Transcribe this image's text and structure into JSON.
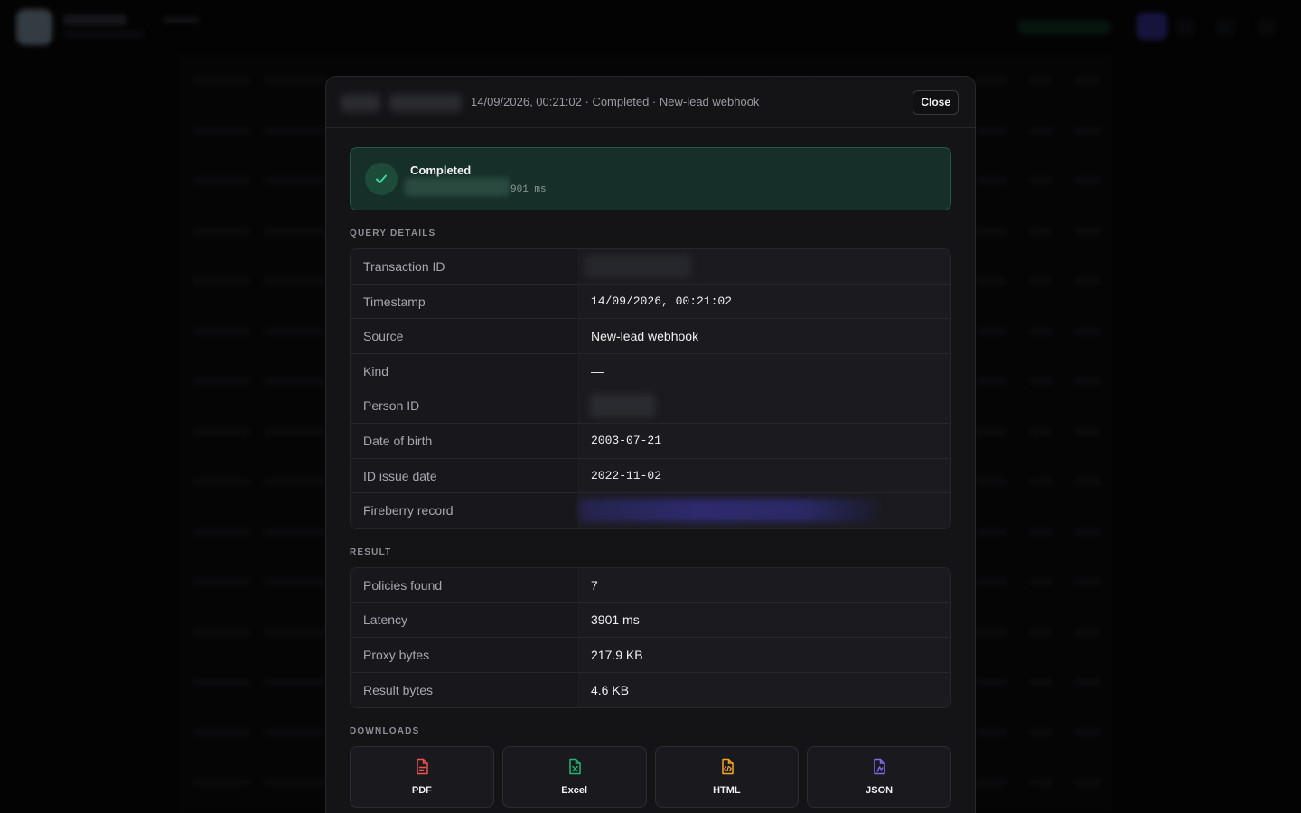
{
  "modal": {
    "header_meta": "14/09/2026, 00:21:02 · Completed · New-lead webhook",
    "close_label": "Close",
    "status": {
      "title": "Completed",
      "latency_text": "901 ms"
    },
    "query_section_label": "QUERY DETAILS",
    "query_details": [
      {
        "key": "Transaction ID",
        "value": "",
        "redacted": true
      },
      {
        "key": "Timestamp",
        "value": "14/09/2026, 00:21:02",
        "mono": true
      },
      {
        "key": "Source",
        "value": "New-lead webhook"
      },
      {
        "key": "Kind",
        "value": "—"
      },
      {
        "key": "Person ID",
        "value": "",
        "redacted": true
      },
      {
        "key": "Date of birth",
        "value": "2003-07-21",
        "mono": true
      },
      {
        "key": "ID issue date",
        "value": "2022-11-02",
        "mono": true
      },
      {
        "key": "Fireberry record",
        "value": "",
        "redacted": true
      }
    ],
    "result_section_label": "RESULT",
    "result": [
      {
        "key": "Policies found",
        "value": "7"
      },
      {
        "key": "Latency",
        "value": "3901 ms"
      },
      {
        "key": "Proxy bytes",
        "value": "217.9 KB"
      },
      {
        "key": "Result bytes",
        "value": "4.6 KB"
      }
    ],
    "downloads_section_label": "DOWNLOADS",
    "downloads": [
      {
        "label": "PDF",
        "icon": "file-pdf-icon",
        "color": "#ef4f4f"
      },
      {
        "label": "Excel",
        "icon": "file-excel-icon",
        "color": "#22b573"
      },
      {
        "label": "HTML",
        "icon": "file-code-icon",
        "color": "#f5a524"
      },
      {
        "label": "JSON",
        "icon": "file-json-icon",
        "color": "#7c6cf0"
      }
    ]
  },
  "colors": {
    "success": "#22b573",
    "accent": "#3b36a8"
  }
}
